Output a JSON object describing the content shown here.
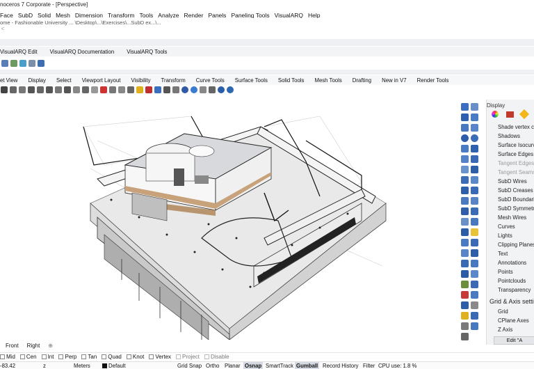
{
  "window": {
    "title": "noceros 7 Corporate - [Perspective]"
  },
  "menu": [
    "Face",
    "SubD",
    "Solid",
    "Mesh",
    "Dimension",
    "Transform",
    "Tools",
    "Analyze",
    "Render",
    "Panels",
    "Paneling Tools",
    "VisualARQ",
    "Help"
  ],
  "command_history": [
    "ome - Fashionable University ... \\Desktop\\...\\Exercises\\...SubD ex...\\..."
  ],
  "toolbar_tabs_top": [
    "VisualARQ Edit",
    "VisualARQ Documentation",
    "VisualARQ Tools"
  ],
  "toolbar_tabs": [
    "et View",
    "Display",
    "Select",
    "Viewport Layout",
    "Visibility",
    "Transform",
    "Curve Tools",
    "Surface Tools",
    "Solid Tools",
    "Mesh Tools",
    "Drafting",
    "New in V7",
    "Render Tools"
  ],
  "display_panel": {
    "title": "Display",
    "items": [
      {
        "label": "Shade vertex co",
        "dim": false
      },
      {
        "label": "Shadows",
        "dim": false
      },
      {
        "label": "Surface Isocurve",
        "dim": false
      },
      {
        "label": "Surface Edges",
        "dim": false
      },
      {
        "label": "Tangent Edges",
        "dim": true
      },
      {
        "label": "Tangent Seams",
        "dim": true
      },
      {
        "label": "SubD Wires",
        "dim": false
      },
      {
        "label": "SubD Creases",
        "dim": false
      },
      {
        "label": "SubD Boundarie",
        "dim": false
      },
      {
        "label": "SubD Symmetry",
        "dim": false
      },
      {
        "label": "Mesh Wires",
        "dim": false
      },
      {
        "label": "Curves",
        "dim": false
      },
      {
        "label": "Lights",
        "dim": false
      },
      {
        "label": "Clipping Planes",
        "dim": false
      },
      {
        "label": "Text",
        "dim": false
      },
      {
        "label": "Annotations",
        "dim": false
      },
      {
        "label": "Points",
        "dim": false
      },
      {
        "label": "Pointclouds",
        "dim": false
      },
      {
        "label": "Transparency",
        "dim": false
      }
    ],
    "grid_header": "Grid & Axis setti",
    "grid_items": [
      "Grid",
      "CPlane Axes",
      "Z Axis"
    ],
    "edit_button": "Edit \"A"
  },
  "viewport_tabs": [
    "Front",
    "Right"
  ],
  "osnaps": [
    "Mid",
    "Cen",
    "Int",
    "Perp",
    "Tan",
    "Quad",
    "Knot",
    "Vertex",
    "Project",
    "Disable"
  ],
  "status": {
    "coord": "-83.42",
    "zlabel": "z",
    "units": "Meters",
    "layer": "Default",
    "grid_snap": "Grid Snap",
    "ortho": "Ortho",
    "planar": "Planar",
    "osnap": "Osnap",
    "smarttrack": "SmartTrack",
    "gumball": "Gumball",
    "record": "Record History",
    "filter": "Filter",
    "cpu": "CPU use: 1.8 %"
  }
}
